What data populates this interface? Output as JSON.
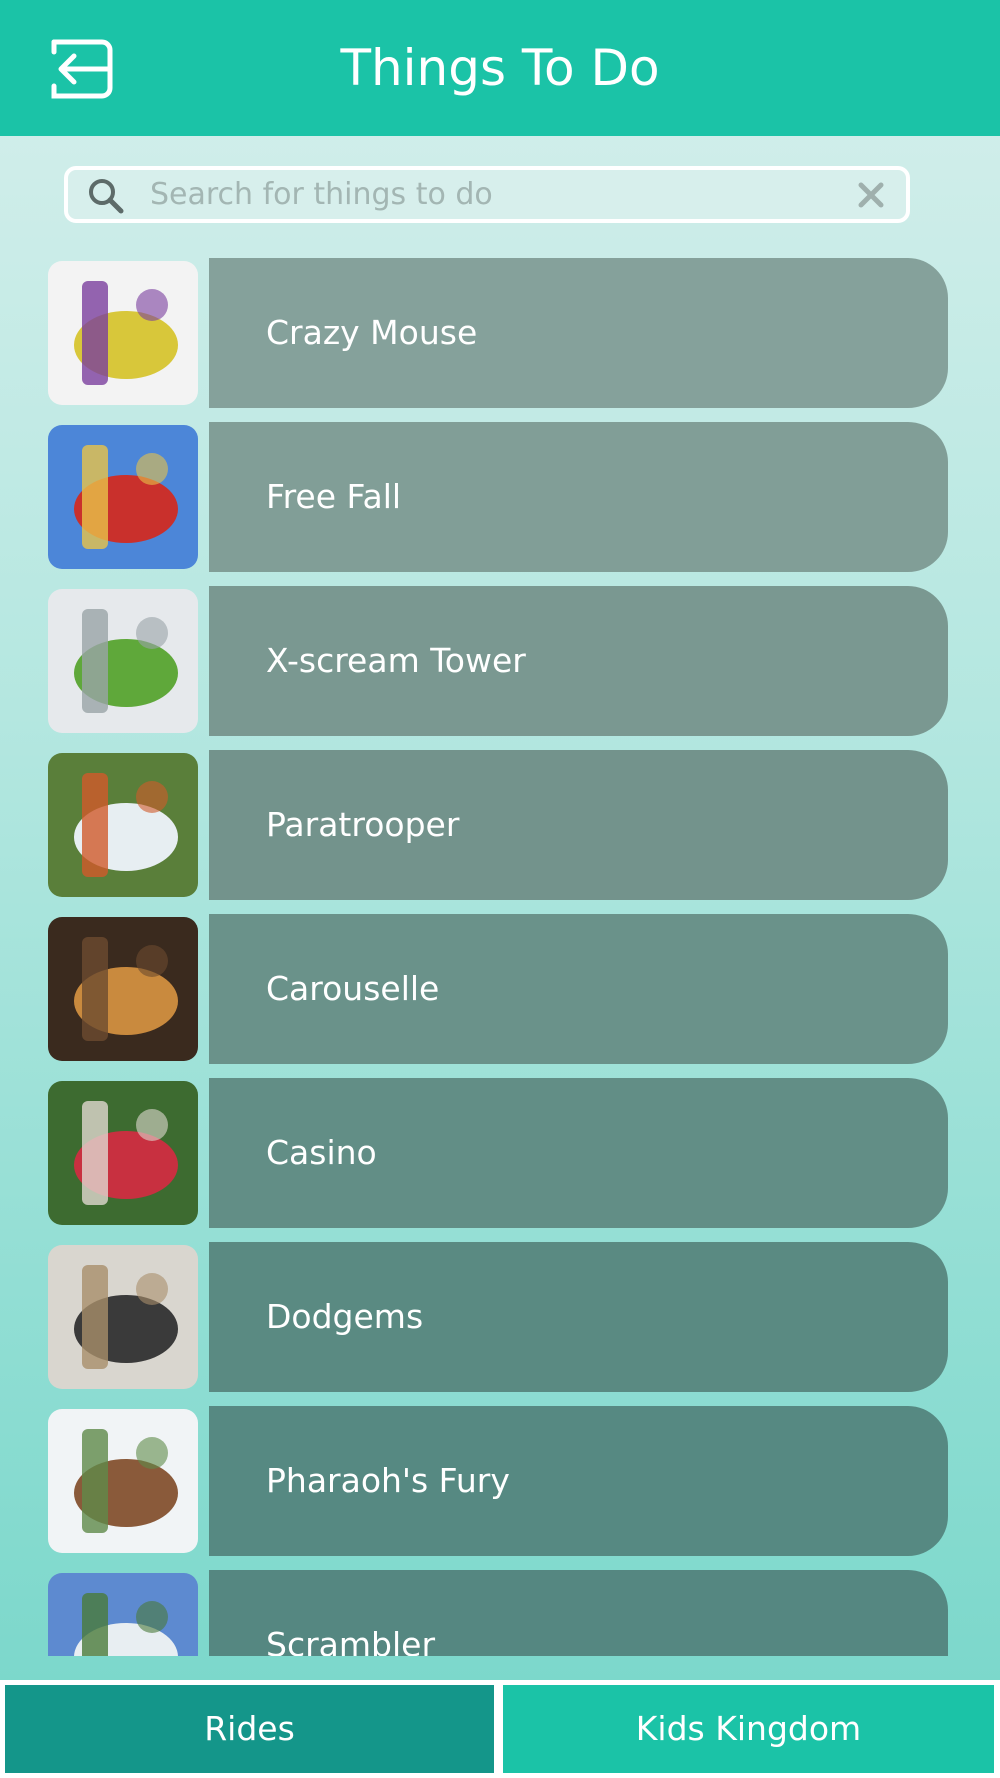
{
  "header": {
    "title": "Things To Do",
    "back_icon": "back-arrow-icon",
    "background": "#1bc3a7"
  },
  "search": {
    "placeholder": "Search for things to do",
    "value": "",
    "search_icon": "search-icon",
    "clear_icon": "close-icon"
  },
  "list": {
    "items": [
      {
        "label": "Crazy Mouse",
        "thumb_colors": [
          "#f3f3f3",
          "#d8c73a",
          "#7a3e9e"
        ],
        "bar_color": "#85a19b"
      },
      {
        "label": "Free Fall",
        "thumb_colors": [
          "#4c86d8",
          "#c9302c",
          "#e8c34a"
        ],
        "bar_color": "#819e97"
      },
      {
        "label": "X-scream Tower",
        "thumb_colors": [
          "#e6e9ec",
          "#5fa83a",
          "#9aa4a8"
        ],
        "bar_color": "#7a9891"
      },
      {
        "label": "Paratrooper",
        "thumb_colors": [
          "#5a7f3a",
          "#e7eef2",
          "#d15a2a"
        ],
        "bar_color": "#73938c"
      },
      {
        "label": "Carouselle",
        "thumb_colors": [
          "#3a2a1e",
          "#c98a3e",
          "#6d4b2f"
        ],
        "bar_color": "#6a928a"
      },
      {
        "label": "Casino",
        "thumb_colors": [
          "#3d6b30",
          "#c83040",
          "#e0d8d0"
        ],
        "bar_color": "#628e86"
      },
      {
        "label": "Dodgems",
        "thumb_colors": [
          "#d9d6cf",
          "#3a3a3a",
          "#a88e6a"
        ],
        "bar_color": "#5a8a82"
      },
      {
        "label": "Pharaoh's Fury",
        "thumb_colors": [
          "#f1f4f6",
          "#8a5a3a",
          "#5f8a4a"
        ],
        "bar_color": "#568982"
      },
      {
        "label": "Scrambler",
        "thumb_colors": [
          "#5d8ad0",
          "#e8eef2",
          "#4a7a3a"
        ],
        "bar_color": "#558781"
      }
    ]
  },
  "tabs": {
    "rides": "Rides",
    "kids_kingdom": "Kids Kingdom",
    "active": "Rides"
  }
}
